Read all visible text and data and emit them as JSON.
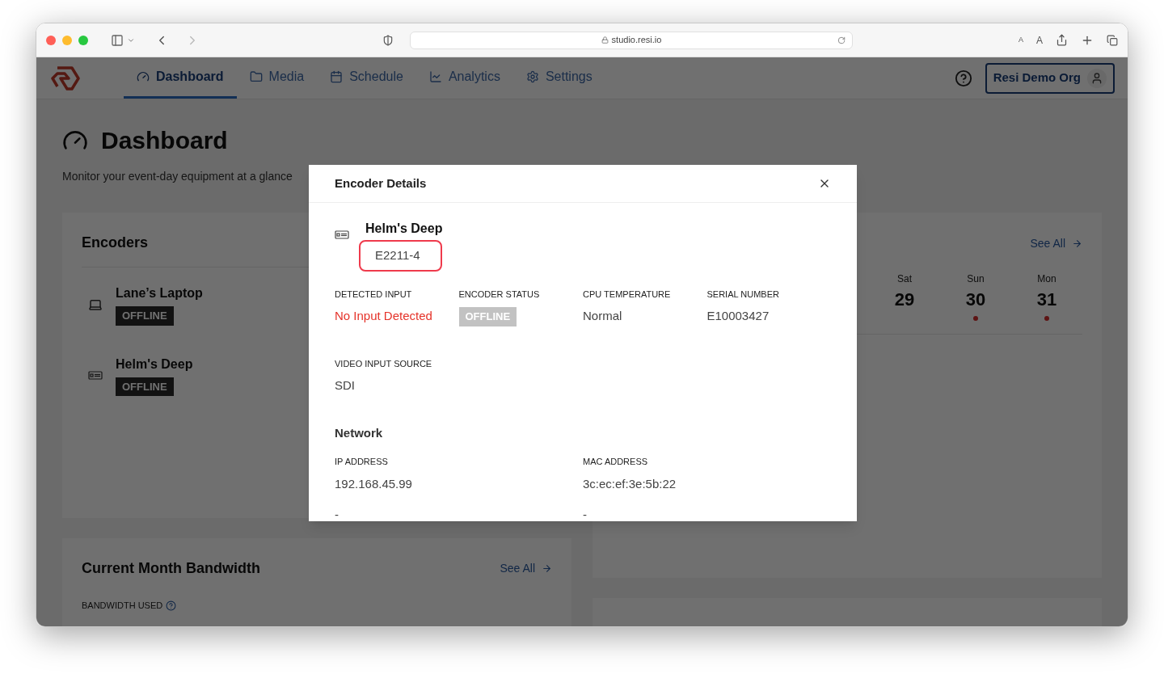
{
  "browser": {
    "url": "studio.resi.io",
    "text_size_buttons": [
      "A",
      "A"
    ]
  },
  "nav": {
    "tabs": [
      {
        "label": "Dashboard",
        "selected": true
      },
      {
        "label": "Media",
        "selected": false
      },
      {
        "label": "Schedule",
        "selected": false
      },
      {
        "label": "Analytics",
        "selected": false
      },
      {
        "label": "Settings",
        "selected": false
      }
    ],
    "org_button": "Resi Demo Org"
  },
  "page": {
    "title": "Dashboard",
    "subtitle": "Monitor your event-day equipment at a glance"
  },
  "encoders_card": {
    "title": "Encoders",
    "items": [
      {
        "name": "Lane’s Laptop",
        "kind": "laptop",
        "status": "OFFLINE"
      },
      {
        "name": "Helm's Deep",
        "kind": "rack",
        "status": "OFFLINE"
      }
    ]
  },
  "schedule_card": {
    "link": "See All",
    "days": [
      {
        "weekday": "Sat",
        "date": "29",
        "has_event": false
      },
      {
        "weekday": "Sun",
        "date": "30",
        "has_event": true
      },
      {
        "weekday": "Mon",
        "date": "31",
        "has_event": true
      }
    ]
  },
  "bandwidth_card": {
    "title": "Current Month Bandwidth",
    "link": "See All",
    "label": "BANDWIDTH USED"
  },
  "modal": {
    "title": "Encoder Details",
    "encoder_name": "Helm's Deep",
    "encoder_id": "E2211-4",
    "id_highlighted": true,
    "fields": [
      {
        "label": "DETECTED INPUT",
        "value": "No Input Detected",
        "kind": "error"
      },
      {
        "label": "ENCODER STATUS",
        "value": "OFFLINE",
        "kind": "badge"
      },
      {
        "label": "CPU TEMPERATURE",
        "value": "Normal",
        "kind": "text"
      },
      {
        "label": "SERIAL NUMBER",
        "value": "E10003427",
        "kind": "text"
      },
      {
        "label": "VIDEO INPUT SOURCE",
        "value": "SDI",
        "kind": "text"
      }
    ],
    "network_title": "Network",
    "network_fields": [
      {
        "label": "IP ADDRESS",
        "value": "192.168.45.99",
        "extra": "-"
      },
      {
        "label": "MAC ADDRESS",
        "value": "3c:ec:ef:3e:5b:22",
        "extra": "-"
      }
    ]
  }
}
